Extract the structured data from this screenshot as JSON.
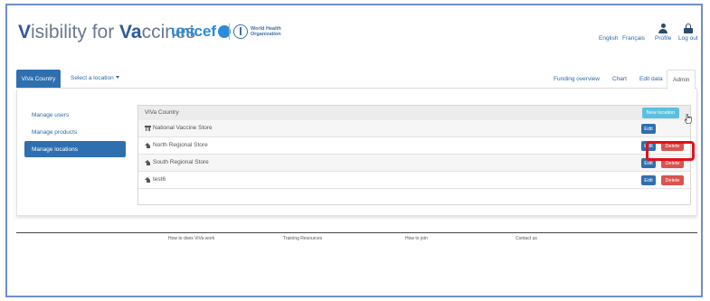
{
  "header": {
    "brand_parts": [
      "V",
      "isibility for ",
      "Va",
      "ccines"
    ],
    "unicef_text": "unicef",
    "who_text": "World Health\nOrganization",
    "lang_english": "English",
    "lang_french": "Français",
    "profile_label": "Profile",
    "logout_label": "Log out"
  },
  "tabs": {
    "country_button": "ViVa Country",
    "location_select": "Select a location",
    "right": [
      "Funding overview",
      "Chart",
      "Edit data",
      "Admin"
    ],
    "active": "Admin"
  },
  "sidebar": {
    "items": [
      {
        "label": "Manage users"
      },
      {
        "label": "Manage products"
      },
      {
        "label": "Manage locations"
      }
    ],
    "active_index": 2
  },
  "panel": {
    "title": "ViVa Country",
    "new_location_label": "New location",
    "edit_label": "Edit",
    "delete_label": "Delete",
    "rows": [
      {
        "icon": "store-icon",
        "name": "National Vaccine Store",
        "deletable": false
      },
      {
        "icon": "home-icon",
        "name": "North Regional Store",
        "deletable": true
      },
      {
        "icon": "home-icon",
        "name": "South Regional Store",
        "deletable": true
      },
      {
        "icon": "home-icon",
        "name": "test6",
        "deletable": true
      }
    ]
  },
  "footer": {
    "links": [
      "How to does ViVa work",
      "Training Resources",
      "How to join",
      "Contact us"
    ]
  },
  "colors": {
    "primary": "#2f6fb0",
    "info": "#5bc0de",
    "danger": "#d9534f",
    "highlight": "#e3101a",
    "frame": "#6f8fc9"
  }
}
